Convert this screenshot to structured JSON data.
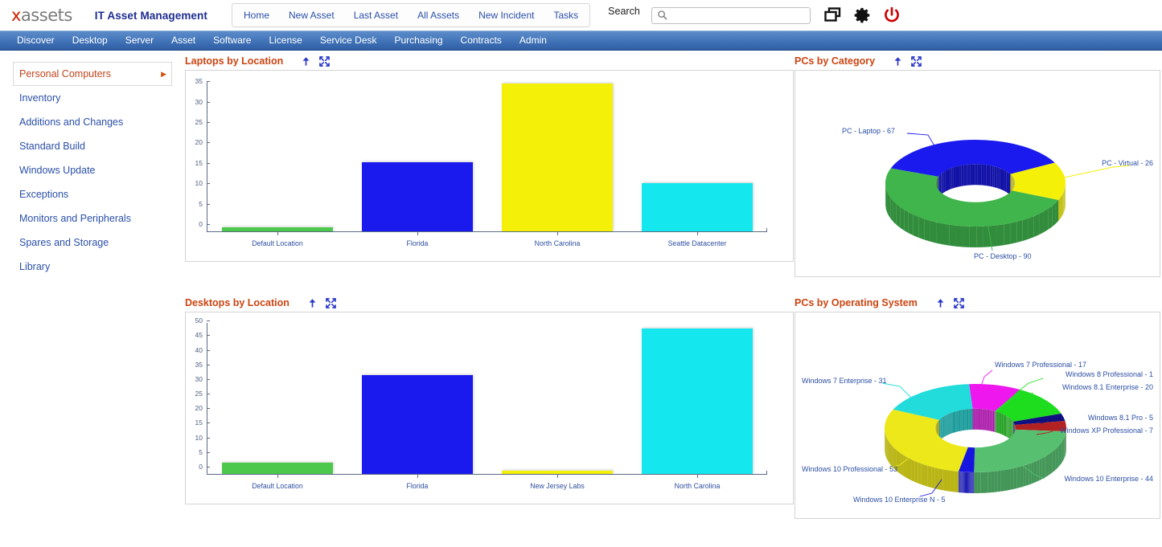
{
  "header": {
    "logo_x": "x",
    "logo_rest": "assets",
    "app_title": "IT Asset Management",
    "nav_links": [
      "Home",
      "New Asset",
      "Last Asset",
      "All Assets",
      "New Incident",
      "Tasks"
    ],
    "search_label": "Search",
    "search_value": "",
    "search_placeholder": "",
    "icons": [
      "windows-restore-icon",
      "gear-icon",
      "power-icon"
    ],
    "power_icon_color": "#cc0000"
  },
  "menu_bar": {
    "items": [
      "Discover",
      "Desktop",
      "Server",
      "Asset",
      "Software",
      "License",
      "Service Desk",
      "Purchasing",
      "Contracts",
      "Admin"
    ],
    "background_color": "#4577bb"
  },
  "sidebar": {
    "items": [
      {
        "label": "Personal Computers",
        "selected": true
      },
      {
        "label": "Inventory",
        "selected": false
      },
      {
        "label": "Additions and Changes",
        "selected": false
      },
      {
        "label": "Standard Build",
        "selected": false
      },
      {
        "label": "Windows Update",
        "selected": false
      },
      {
        "label": "Exceptions",
        "selected": false
      },
      {
        "label": "Monitors and Peripherals",
        "selected": false
      },
      {
        "label": "Spares and Storage",
        "selected": false
      },
      {
        "label": "Library",
        "selected": false
      }
    ],
    "selected_color": "#c0461d",
    "link_color": "#2a4fa8"
  },
  "panels": {
    "laptops": {
      "title": "Laptops by Location"
    },
    "desktops": {
      "title": "Desktops by Location"
    },
    "pc_category": {
      "title": "PCs by Category"
    },
    "pc_os": {
      "title": "PCs by Operating System"
    },
    "tool_collapse": "up-arrow-icon",
    "tool_expand": "expand-icon",
    "title_color": "#cc4411"
  },
  "chart_data": [
    {
      "id": "laptops_by_location",
      "type": "bar",
      "title": "Laptops by Location",
      "xlabel": "",
      "ylabel": "",
      "ylim": [
        0,
        37
      ],
      "yticks": [
        0,
        5,
        10,
        15,
        20,
        25,
        30,
        35
      ],
      "grid": false,
      "legend": "none",
      "categories": [
        "Default Location",
        "Florida",
        "North Carolina",
        "Seattle Datacenter"
      ],
      "values": [
        1,
        17,
        36.5,
        11.8
      ],
      "colors": [
        "#4CC94C",
        "#1A1AEE",
        "#F5F008",
        "#14E8EE"
      ]
    },
    {
      "id": "desktops_by_location",
      "type": "bar",
      "title": "Desktops by Location",
      "xlabel": "",
      "ylabel": "",
      "ylim": [
        0,
        52
      ],
      "yticks": [
        0,
        5,
        10,
        15,
        20,
        25,
        30,
        35,
        40,
        45,
        50
      ],
      "grid": false,
      "legend": "none",
      "categories": [
        "Default Location",
        "Florida",
        "New Jersey Labs",
        "North Carolina"
      ],
      "values": [
        4,
        34,
        1.2,
        50
      ],
      "colors": [
        "#4CC94C",
        "#1A1AEE",
        "#F5F008",
        "#14E8EE"
      ]
    },
    {
      "id": "pcs_by_category",
      "type": "pie",
      "title": "PCs by Category",
      "donut": true,
      "legend": "callout-labels",
      "slices": [
        {
          "label": "PC - Laptop - 67",
          "name": "PC - Laptop",
          "value": 67,
          "color": "#1A1AEE"
        },
        {
          "label": "PC - Virtual - 26",
          "name": "PC - Virtual",
          "value": 26,
          "color": "#F5F008"
        },
        {
          "label": "PC - Desktop - 90",
          "name": "PC - Desktop",
          "value": 90,
          "color": "#3FB54B"
        }
      ]
    },
    {
      "id": "pcs_by_operating_system",
      "type": "pie",
      "title": "PCs by Operating System",
      "donut": true,
      "legend": "callout-labels",
      "slices": [
        {
          "label": "Windows 7 Professional - 17",
          "name": "Windows 7 Professional",
          "value": 17,
          "color": "#EE18EE"
        },
        {
          "label": "Windows 8 Professional - 1",
          "name": "Windows 8 Professional",
          "value": 1,
          "color": "#1EDC1E"
        },
        {
          "label": "Windows 8.1 Enterprise - 20",
          "name": "Windows 8.1 Enterprise",
          "value": 20,
          "color": "#1EDC1E"
        },
        {
          "label": "Windows 8.1 Pro - 5",
          "name": "Windows 8.1 Pro",
          "value": 5,
          "color": "#101080"
        },
        {
          "label": "Windows XP Professional - 7",
          "name": "Windows XP Professional",
          "value": 7,
          "color": "#B22222"
        },
        {
          "label": "Windows 10 Enterprise - 44",
          "name": "Windows 10 Enterprise",
          "value": 44,
          "color": "#56C070"
        },
        {
          "label": "Windows 10 Enterprise N - 5",
          "name": "Windows 10 Enterprise N",
          "value": 5,
          "color": "#1616E0"
        },
        {
          "label": "Windows 10 Professional - 53",
          "name": "Windows 10 Professional",
          "value": 53,
          "color": "#EDE81A"
        },
        {
          "label": "Windows 7 Enterprise - 31",
          "name": "Windows 7 Enterprise",
          "value": 31,
          "color": "#22DCDC"
        }
      ]
    }
  ]
}
